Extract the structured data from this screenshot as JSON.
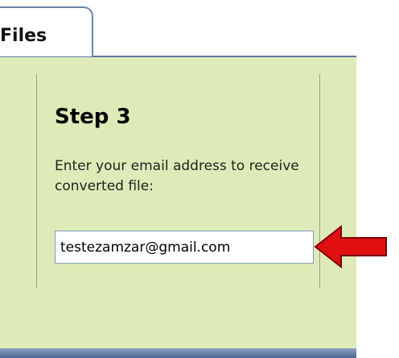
{
  "tab": {
    "label": "Files"
  },
  "step": {
    "title": "Step 3",
    "instructions": "Enter your email address to receive converted file:",
    "email_value": "testezamzar@gmail.com"
  },
  "colors": {
    "panel_background": "#deebb8",
    "panel_border": "#5d76a3",
    "arrow": "#e01010"
  },
  "icons": {
    "pointer": "red-arrow-icon"
  }
}
